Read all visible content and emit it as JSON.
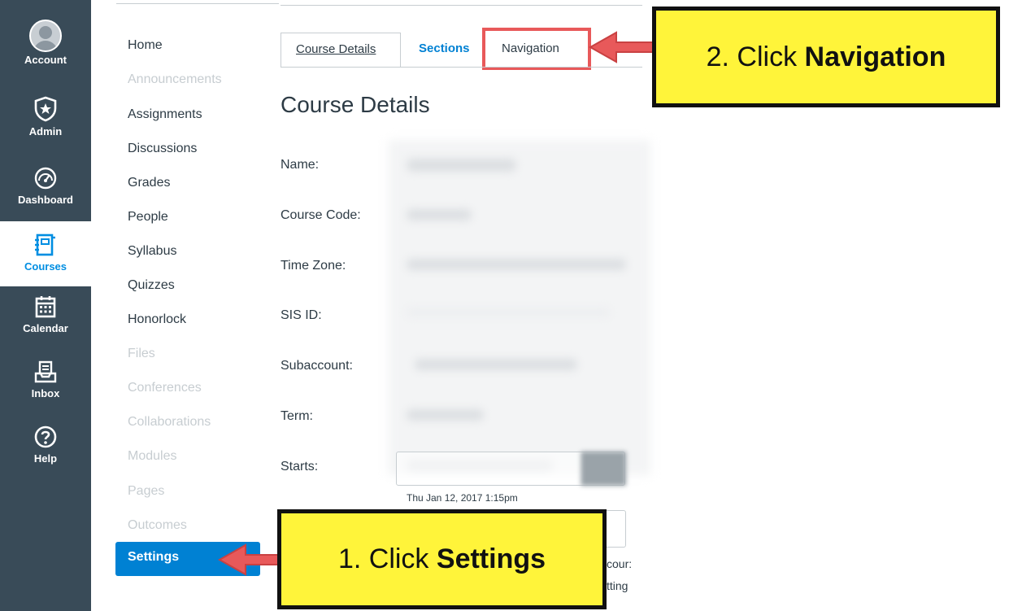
{
  "global_nav": {
    "items": [
      {
        "label": "Account",
        "icon": "account-avatar-icon"
      },
      {
        "label": "Admin",
        "icon": "shield-star-icon"
      },
      {
        "label": "Dashboard",
        "icon": "dashboard-gauge-icon"
      },
      {
        "label": "Courses",
        "icon": "book-icon",
        "active": true
      },
      {
        "label": "Calendar",
        "icon": "calendar-icon"
      },
      {
        "label": "Inbox",
        "icon": "inbox-icon"
      },
      {
        "label": "Help",
        "icon": "help-circle-icon"
      }
    ]
  },
  "course_nav": {
    "items": [
      {
        "label": "Home"
      },
      {
        "label": "Announcements",
        "disabled": true
      },
      {
        "label": "Assignments"
      },
      {
        "label": "Discussions"
      },
      {
        "label": "Grades"
      },
      {
        "label": "People"
      },
      {
        "label": "Syllabus"
      },
      {
        "label": "Quizzes"
      },
      {
        "label": "Honorlock"
      },
      {
        "label": "Files",
        "disabled": true
      },
      {
        "label": "Conferences",
        "disabled": true
      },
      {
        "label": "Collaborations",
        "disabled": true
      },
      {
        "label": "Modules",
        "disabled": true
      },
      {
        "label": "Pages",
        "disabled": true
      },
      {
        "label": "Outcomes",
        "disabled": true
      },
      {
        "label": "Settings",
        "active": true
      }
    ]
  },
  "tabs": {
    "course_details": "Course Details",
    "sections": "Sections",
    "navigation": "Navigation"
  },
  "main": {
    "title": "Course Details",
    "fields": {
      "name": "Name:",
      "course_code": "Course Code:",
      "time_zone": "Time Zone:",
      "sis_id": "SIS ID:",
      "subaccount": "Subaccount:",
      "term": "Term:",
      "starts": "Starts:"
    },
    "start_date_hint": "Thu Jan 12, 2017 1:15pm",
    "fragment_1": "cour:",
    "fragment_2": "tting"
  },
  "callouts": {
    "step1_prefix": "1. Click ",
    "step1_bold": "Settings",
    "step2_prefix": "2. Click ",
    "step2_bold": "Navigation"
  },
  "colors": {
    "nav_bg": "#394b58",
    "link_blue": "#0081d3",
    "callout_yellow": "#fff43a",
    "highlight_red": "#e8595a"
  }
}
